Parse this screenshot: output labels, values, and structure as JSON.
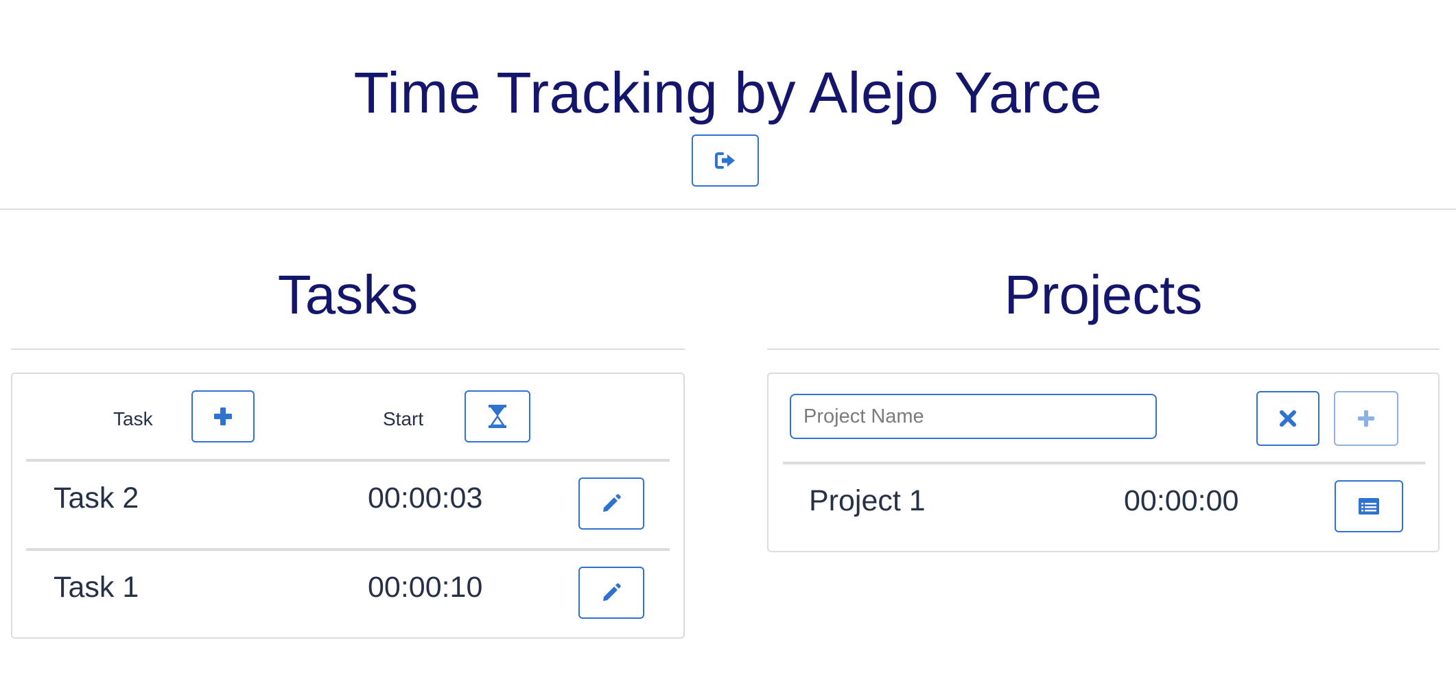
{
  "header": {
    "title": "Time Tracking by Alejo Yarce",
    "logout_icon": "sign-out-icon"
  },
  "tasks": {
    "title": "Tasks",
    "column_task": "Task",
    "column_start": "Start",
    "add_icon": "plus-icon",
    "start_icon": "hourglass-icon",
    "rows": [
      {
        "name": "Task 2",
        "time": "00:00:03",
        "action_icon": "pencil-icon"
      },
      {
        "name": "Task 1",
        "time": "00:00:10",
        "action_icon": "pencil-icon"
      }
    ]
  },
  "projects": {
    "title": "Projects",
    "input": {
      "placeholder": "Project Name",
      "value": ""
    },
    "cancel_icon": "close-icon",
    "add_icon": "plus-icon",
    "rows": [
      {
        "name": "Project 1",
        "time": "00:00:00",
        "action_icon": "list-icon"
      }
    ]
  },
  "colors": {
    "title": "#14166b",
    "accent": "#2f72cf",
    "text": "#263148",
    "border": "#dcdcdc"
  }
}
